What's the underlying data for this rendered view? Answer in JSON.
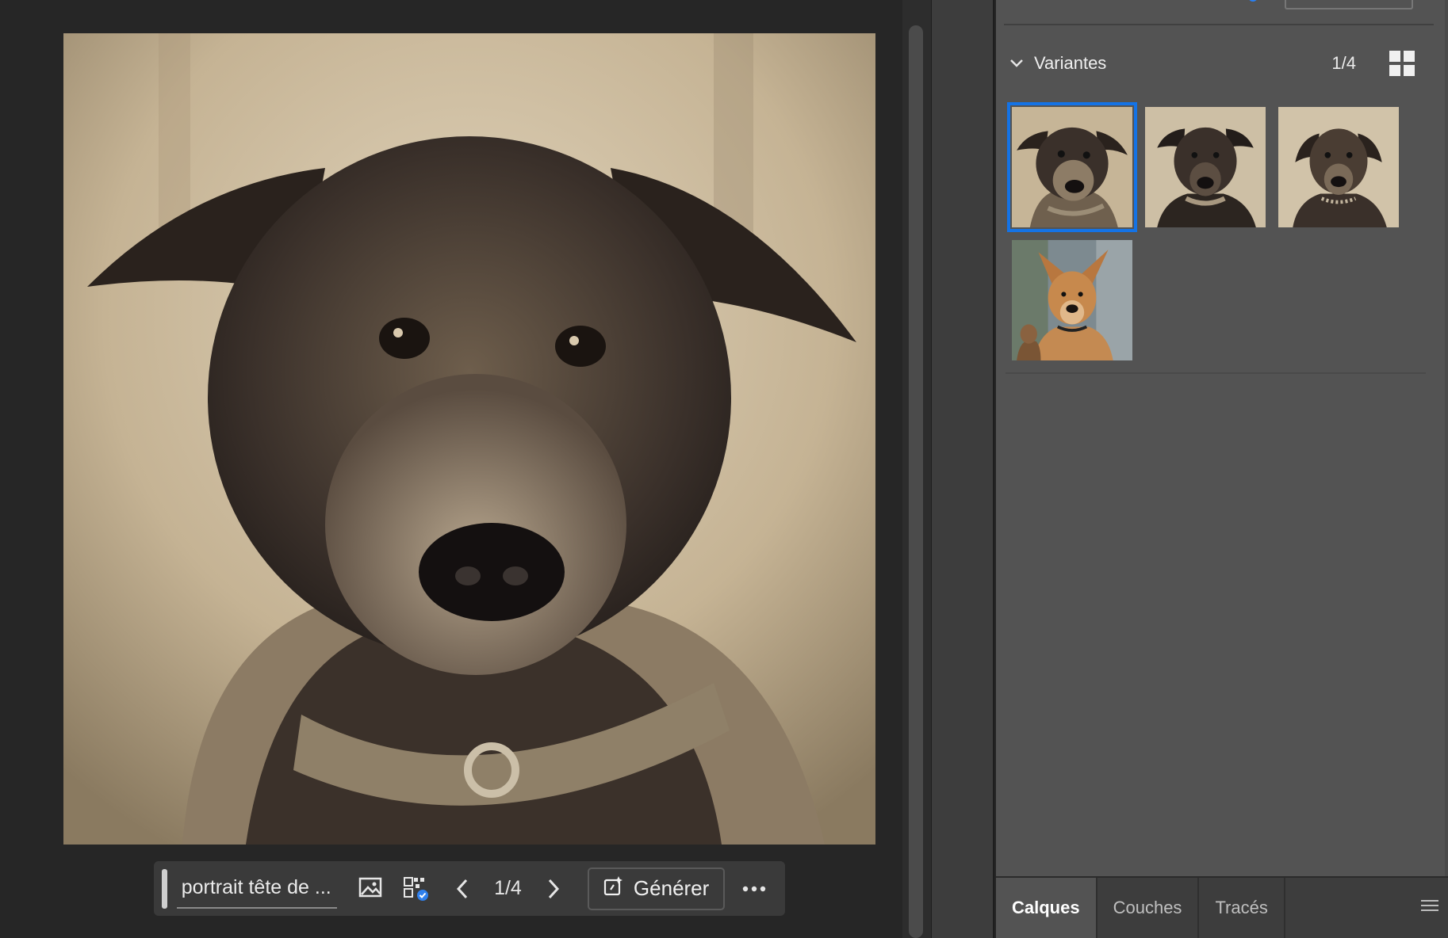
{
  "canvas": {
    "image_subject": "sepia-dog-portrait"
  },
  "taskbar": {
    "prompt_text": "portrait tête de ...",
    "counter": "1/4",
    "generate_label": "Générer",
    "icons": [
      "reference-image-icon",
      "content-type-icon",
      "chevron-left-icon",
      "chevron-right-icon",
      "generate-icon",
      "more-icon"
    ]
  },
  "variants": {
    "title": "Variantes",
    "count": "1/4",
    "selected_index": 0,
    "items": [
      {
        "name": "variant-1",
        "tone": "sepia"
      },
      {
        "name": "variant-2",
        "tone": "sepia"
      },
      {
        "name": "variant-3",
        "tone": "sepia"
      },
      {
        "name": "variant-4",
        "tone": "color"
      }
    ]
  },
  "tabs": [
    {
      "label": "Calques",
      "active": true
    },
    {
      "label": "Couches",
      "active": false
    },
    {
      "label": "Tracés",
      "active": false
    }
  ],
  "colors": {
    "selection": "#1473e6",
    "panel_bg": "#535353",
    "canvas_bg": "#262626"
  }
}
